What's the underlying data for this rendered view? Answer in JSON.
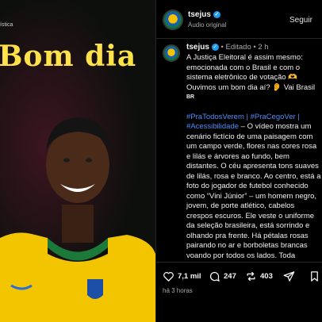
{
  "media": {
    "brand_text": "ística",
    "greeting": "Bom dia"
  },
  "header": {
    "username": "tsejus",
    "subtitle": "Áudio original",
    "follow_label": "Seguir",
    "more_label": "•••"
  },
  "caption": {
    "username": "tsejus",
    "edited": "Editado",
    "time_ago": "2 h",
    "lines": [
      "A Justiça Eleitoral é assim mesmo: emocionada com o Brasil e com o sistema eletrônico de votação 🫶 Ouvimos um bom dia aí? 👂 Vai Brasil"
    ],
    "flag_code": "BR",
    "hashtags": "#PraTodosVerem | #PraCegoVer | #Acessibilidade",
    "description": " – O vídeo mostra um cenário fictício de uma paisagem com um campo verde, flores nas cores rosa e lilás e árvores ao fundo, bem distantes. O céu apresenta tons suaves de lilás, rosa e branco. Ao centro, está a foto do jogador de futebol conhecido como “Vini Júnior” – um homem negro, jovem, de porte atlético, cabelos crespos escuros. Ele veste o uniforme da seleção brasileira, está sorrindo e olhando pra frente. Há pétalas rosas pairando no ar e borboletas brancas voando por todos os lados. Toda"
  },
  "actions": {
    "likes": "7,1 mil",
    "comments": "247",
    "reposts": "403"
  },
  "footer": {
    "time": "há 3 horas"
  },
  "colors": {
    "accent": "#ffe24a",
    "link": "#4b8ef5",
    "verified": "#1d9bf0"
  }
}
